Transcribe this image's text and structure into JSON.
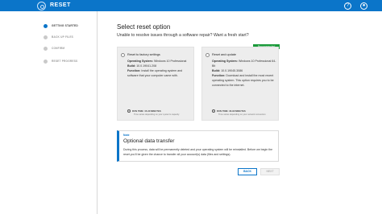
{
  "header": {
    "title": "RESET",
    "help_icon": "help-icon",
    "user_icon": "user-icon"
  },
  "sidebar": {
    "steps": [
      {
        "label": "GETTING STARTED",
        "active": true
      },
      {
        "label": "BACK UP FILES",
        "active": false
      },
      {
        "label": "CONFIRM",
        "active": false
      },
      {
        "label": "RESET PROGRESS",
        "active": false
      }
    ]
  },
  "main": {
    "title": "Select reset option",
    "subtitle": "Unable to resolve issues through a software repair? Want a fresh start?",
    "options": [
      {
        "title": "Reset to factory settings",
        "os_label": "Operating System:",
        "os_value": "Windows 10 Professional",
        "build_label": "Build:",
        "build_value": "10.0.19041.208",
        "function_label": "Function:",
        "function_value": "Install the operating system and software that your computer came with.",
        "runtime": "RUN TIME: 15-30 MINUTES",
        "runtime_note": "Time varies depending on your system's capacity"
      },
      {
        "title": "Reset and update",
        "os_label": "Operating System:",
        "os_value": "Windows 10 Professional 64-Bit",
        "build_label": "Build:",
        "build_value": "10.0.19045.3086",
        "function_label": "Function:",
        "function_value": "Download and install the most recent operating system. This option requires you to be connected to the internet.",
        "runtime": "RUN TIME: 30-90 MINUTES",
        "runtime_note": "Time varies depending on your network connection"
      }
    ],
    "badge": "Recommended",
    "note": {
      "label": "Note",
      "heading": "Optional data transfer",
      "body": "During this process, data will be permanently deleted and your operating system will be reinstalled. Before we begin the reset you'll be given the chance to transfer all your account(s) data (files and settings)."
    },
    "buttons": {
      "back": "BACK",
      "next": "NEXT"
    }
  }
}
